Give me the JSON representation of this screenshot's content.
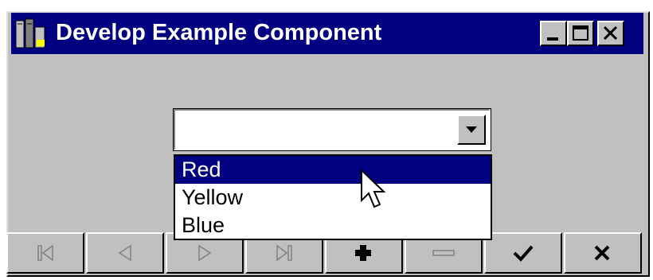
{
  "window": {
    "title": "Develop Example Component",
    "icon": "application-icon",
    "caption_buttons": [
      "minimize-icon",
      "maximize-icon",
      "close-icon"
    ]
  },
  "combo": {
    "value": "",
    "options": [
      {
        "label": "Red",
        "selected": true
      },
      {
        "label": "Yellow",
        "selected": false
      },
      {
        "label": "Blue",
        "selected": false
      }
    ]
  },
  "navigator": {
    "buttons": [
      {
        "name": "first-record",
        "icon": "first-icon",
        "enabled": false
      },
      {
        "name": "prior-record",
        "icon": "prior-icon",
        "enabled": false
      },
      {
        "name": "next-record",
        "icon": "next-icon",
        "enabled": false
      },
      {
        "name": "last-record",
        "icon": "last-icon",
        "enabled": false
      },
      {
        "name": "insert-record",
        "icon": "plus-icon",
        "enabled": true
      },
      {
        "name": "delete-record",
        "icon": "minus-icon",
        "enabled": false
      },
      {
        "name": "post-edit",
        "icon": "checkmark-icon",
        "enabled": true
      },
      {
        "name": "cancel-edit",
        "icon": "x-icon",
        "enabled": true
      }
    ]
  },
  "colors": {
    "titlebar": "#000080",
    "face": "#c0c0c0",
    "selection": "#000080",
    "disabled_glyph": "#808080"
  }
}
